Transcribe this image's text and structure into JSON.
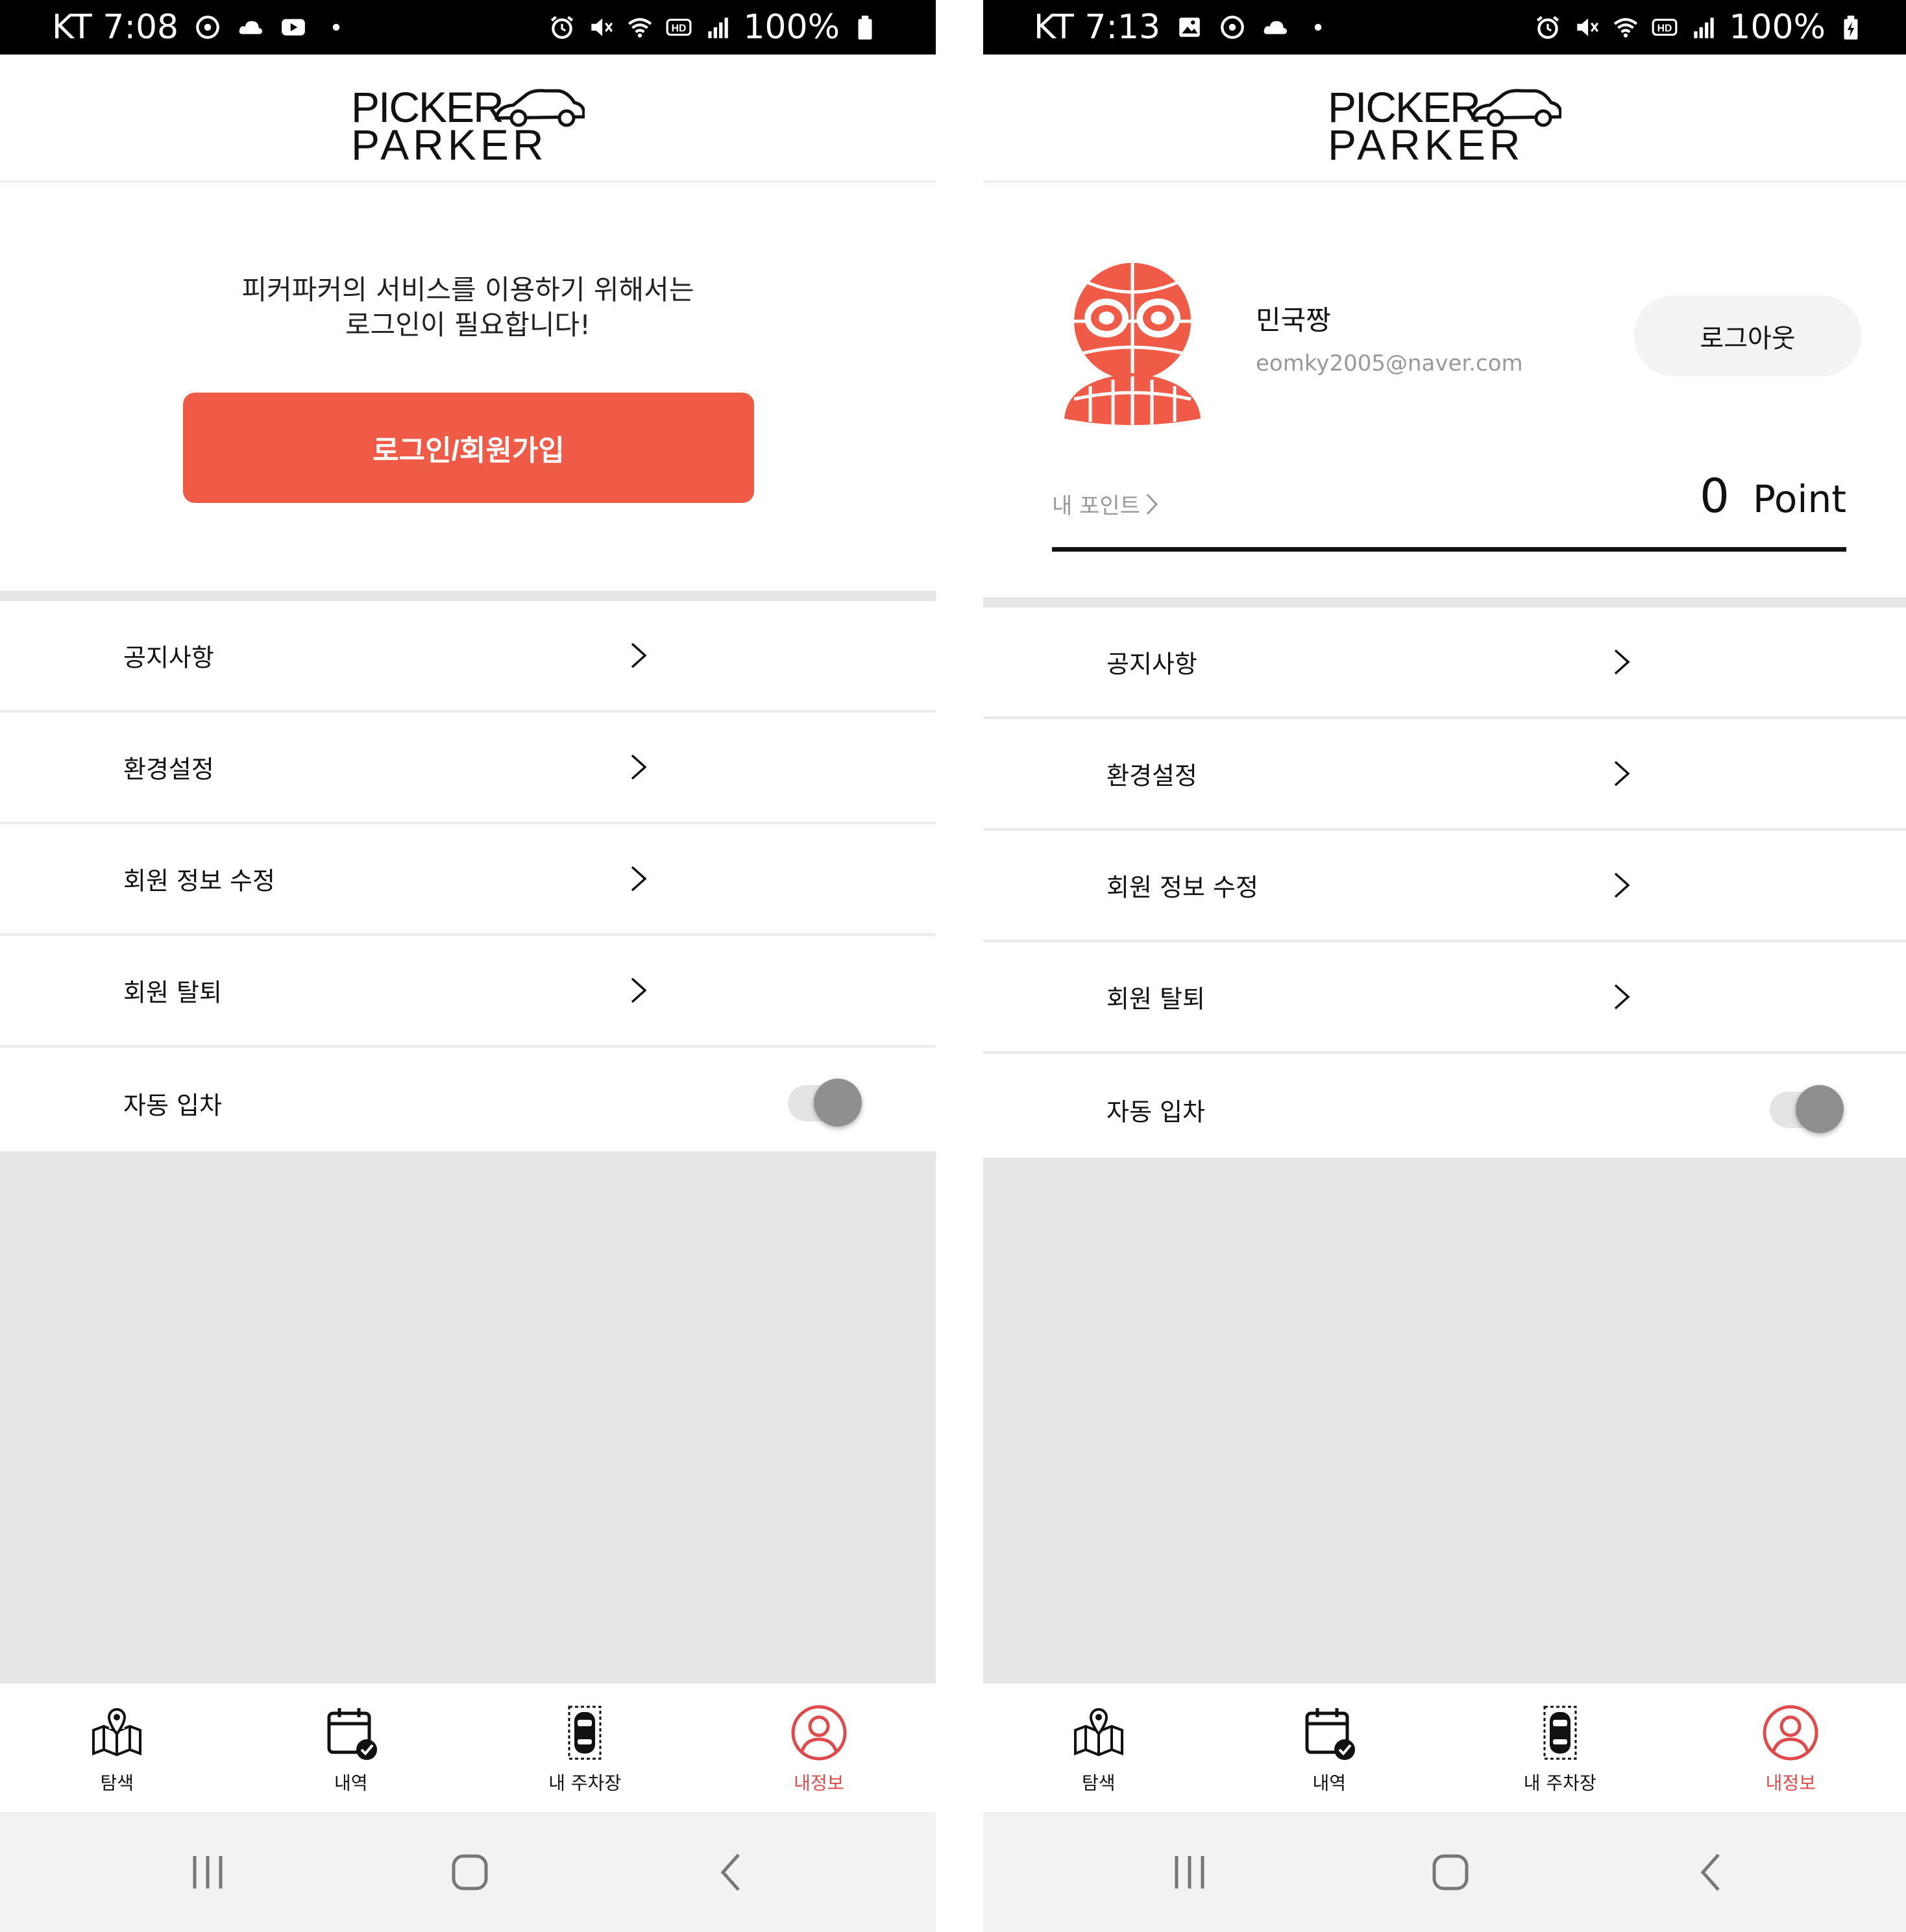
{
  "colors": {
    "accent": "#f05b48",
    "active_tab": "#e04a4a",
    "gray_bg": "#e6e6e6",
    "status_bar": "#000000"
  },
  "left": {
    "status": {
      "carrier_time": "KT 7:08",
      "battery": "100%"
    },
    "notice_line1": "피커파커의 서비스를 이용하기 위해서는",
    "notice_line2": "로그인이 필요합니다!",
    "login_button": "로그인/회원가입",
    "menu": [
      {
        "label": "공지사항"
      },
      {
        "label": "환경설정"
      },
      {
        "label": "회원 정보 수정"
      },
      {
        "label": "회원 탈퇴"
      }
    ],
    "auto_entry": {
      "label": "자동 입차",
      "enabled": false
    },
    "nav": [
      {
        "label": "탐색",
        "icon": "map-pin-icon"
      },
      {
        "label": "내역",
        "icon": "calendar-check-icon"
      },
      {
        "label": "내 주차장",
        "icon": "car-parking-icon"
      },
      {
        "label": "내정보",
        "icon": "user-circle-icon",
        "active": true
      }
    ]
  },
  "right": {
    "status": {
      "carrier_time": "KT 7:13",
      "battery": "100%"
    },
    "profile": {
      "name": "민국짱",
      "email": "eomky2005@naver.com",
      "logout_button": "로그아웃"
    },
    "points": {
      "label": "내 포인트",
      "value": "0",
      "unit": "Point"
    },
    "menu": [
      {
        "label": "공지사항"
      },
      {
        "label": "환경설정"
      },
      {
        "label": "회원 정보 수정"
      },
      {
        "label": "회원 탈퇴"
      }
    ],
    "auto_entry": {
      "label": "자동 입차",
      "enabled": false
    },
    "nav": [
      {
        "label": "탐색",
        "icon": "map-pin-icon"
      },
      {
        "label": "내역",
        "icon": "calendar-check-icon"
      },
      {
        "label": "내 주차장",
        "icon": "car-parking-icon"
      },
      {
        "label": "내정보",
        "icon": "user-circle-icon",
        "active": true
      }
    ]
  }
}
